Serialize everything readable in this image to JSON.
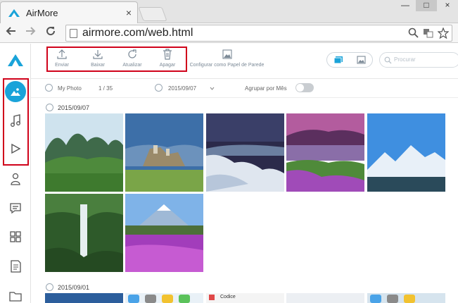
{
  "browser": {
    "tab_title": "AirMore",
    "url": "airmore.com/web.html",
    "close_glyph": "×",
    "window_buttons": [
      "—",
      "□",
      "×"
    ]
  },
  "toolbar": {
    "actions": [
      {
        "label": "Enviar",
        "icon": "upload-icon"
      },
      {
        "label": "Baixar",
        "icon": "download-icon"
      },
      {
        "label": "Atualizar",
        "icon": "refresh-icon"
      },
      {
        "label": "Apagar",
        "icon": "trash-icon"
      },
      {
        "label": "Configurar como Papel de Parede",
        "icon": "wallpaper-icon"
      }
    ],
    "search_placeholder": "Procurar"
  },
  "filters": {
    "album": "My Photo",
    "album_count": "1 / 35",
    "date_select": "2015/09/07",
    "group_label": "Agrupar por Mês",
    "group_by_month": false
  },
  "groups": [
    {
      "date": "2015/09/07",
      "photo_count": 7
    },
    {
      "date": "2015/09/01"
    }
  ],
  "preview_texts": {
    "codice": "Codice"
  },
  "colors": {
    "accent": "#1aa3d9",
    "highlight": "#d0021b"
  }
}
